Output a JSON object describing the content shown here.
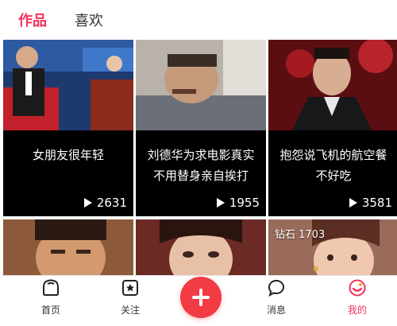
{
  "tabs": [
    {
      "label": "作品",
      "active": true
    },
    {
      "label": "喜欢",
      "active": false
    }
  ],
  "cards": [
    {
      "title": "女朋友很年轻",
      "plays": "2631"
    },
    {
      "title": "刘德华为求电影真实不用替身亲自挨打",
      "plays": "1955"
    },
    {
      "title": "抱怨说飞机的航空餐不好吃",
      "plays": "3581"
    }
  ],
  "bottom_row": [
    {
      "badge": ""
    },
    {
      "badge": ""
    },
    {
      "badge": "钻石 1703"
    }
  ],
  "nav": [
    {
      "label": "首页",
      "icon": "home-icon"
    },
    {
      "label": "关注",
      "icon": "follow-icon"
    },
    {
      "label": "",
      "icon": "plus-icon"
    },
    {
      "label": "消息",
      "icon": "message-icon"
    },
    {
      "label": "我的",
      "icon": "profile-icon"
    }
  ],
  "colors": {
    "accent": "#f2335a",
    "plus_button": "#f23b42"
  }
}
